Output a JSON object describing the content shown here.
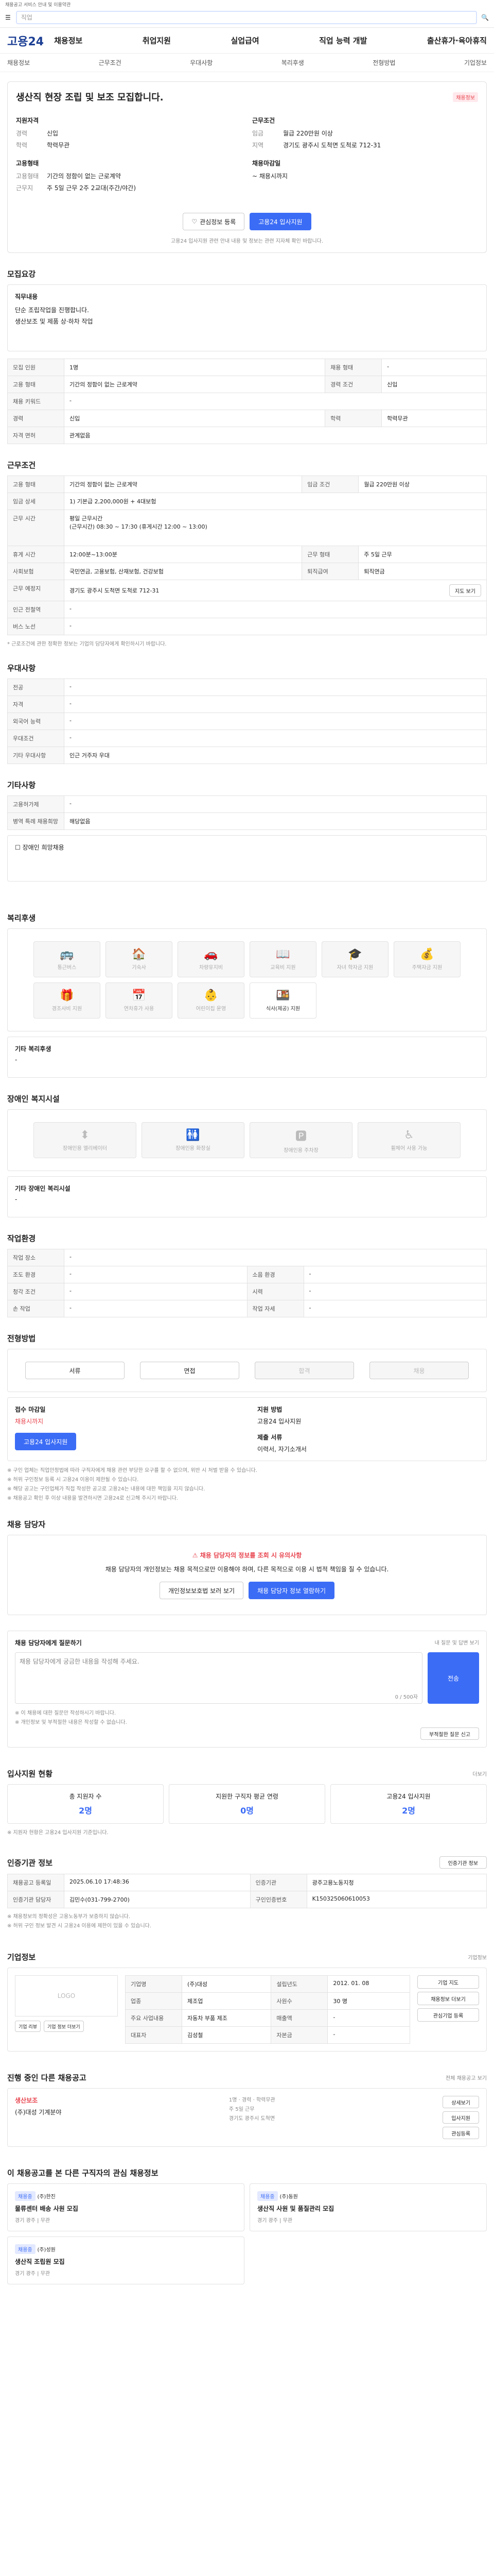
{
  "notice": "채용공고 서비스 안내 및 이용약관",
  "search": {
    "placeholder": "직업"
  },
  "gnb": {
    "logo": "고용24",
    "menu": [
      "채용정보",
      "취업지원",
      "실업급여",
      "직업 능력 개발",
      "출산휴가·육아휴직"
    ]
  },
  "subnav": [
    "채용정보",
    "근무조건",
    "우대사항",
    "복리후생",
    "전형방법",
    "기업정보"
  ],
  "hero": {
    "title": "생산직 현장 조립 및 보조 모집합니다.",
    "badge": "채용정보",
    "left_heading": "지원자격",
    "left": [
      {
        "k": "경력",
        "v": "신입"
      },
      {
        "k": "학력",
        "v": "학력무관"
      }
    ],
    "left2_heading": "고용형태",
    "left2": [
      {
        "k": "고용형태",
        "v": "기간의 정함이 없는 근로계약"
      },
      {
        "k": "근무지",
        "v": "주 5일 근무 2주 2교대(주간/야간)"
      }
    ],
    "right_heading": "근무조건",
    "right": [
      {
        "k": "임금",
        "v": "월급 220만원 이상"
      },
      {
        "k": "지역",
        "v": "경기도 광주시 도척면 도척로 712-31"
      }
    ],
    "right2_heading": "채용마감일",
    "right2": "~ 채용시까지",
    "btn_scrap": "관심정보 등록",
    "btn_apply": "고용24 입사지원",
    "footnote": "고용24 입사지원 관련 안내 내용 및 정보는 관련 지자체 확인 바랍니다."
  },
  "recruit": {
    "title": "모집요강",
    "job_title": "직무내용",
    "job_desc": "단순 조립작업을 진행합니다.\n생산보조 및 제품 상·하차 작업",
    "rows": [
      [
        {
          "k": "모집 인원",
          "v": "1명"
        },
        {
          "k": "채용 형태",
          "v": "-"
        }
      ],
      [
        {
          "k": "고용 형태",
          "v": "기간의 정함이 없는 근로계약"
        },
        {
          "k": "경력 조건",
          "v": "신입"
        }
      ],
      [
        {
          "k": "채용 키워드",
          "v": "-"
        },
        {
          "k": "",
          "v": ""
        }
      ],
      [
        {
          "k": "경력",
          "v": "신입"
        },
        {
          "k": "학력",
          "v": "학력무관"
        }
      ],
      [
        {
          "k": "자격 면허",
          "v": "관계없음"
        },
        {
          "k": "",
          "v": ""
        }
      ]
    ]
  },
  "conditions": {
    "title": "근무조건",
    "rows": [
      [
        {
          "k": "고용 형태",
          "v": "기간의 정함이 없는 근로계약"
        },
        {
          "k": "임금 조건",
          "v": "월급 220만원 이상"
        }
      ],
      [
        {
          "k": "임금 상세",
          "v": "1) 기본급 2,200,000원 + 4대보험"
        },
        {
          "k": "",
          "v": ""
        }
      ],
      [
        {
          "k": "근무 시간",
          "v": "평일 근무시간 \n(근무시간) 08:30 ~ 17:30 (휴게시간 12:00 ~ 13:00)"
        },
        {
          "k": "",
          "v": ""
        }
      ],
      [
        {
          "k": "휴게 시간",
          "v": "12:00분~13:00분"
        },
        {
          "k": "근무 형태",
          "v": "주 5일 근무"
        }
      ],
      [
        {
          "k": "사회보험",
          "v": "국민연금, 고용보험, 산재보험, 건강보험"
        },
        {
          "k": "퇴직급여",
          "v": "퇴직연금"
        }
      ],
      [
        {
          "k": "근무 예정지",
          "v": "경기도 광주시 도척면 도척로 712-31"
        },
        {
          "k": "",
          "v": ""
        }
      ],
      [
        {
          "k": "인근 전철역",
          "v": "-"
        },
        {
          "k": "",
          "v": ""
        }
      ],
      [
        {
          "k": "버스 노선",
          "v": "-"
        },
        {
          "k": "",
          "v": ""
        }
      ]
    ],
    "map_btn": "지도 보기",
    "note": "* 근로조건에 관한 정확한 정보는 기업의 담당자에게 확인하시기 바랍니다."
  },
  "preference": {
    "title": "우대사항",
    "rows": [
      {
        "k": "전공",
        "v": "-"
      },
      {
        "k": "자격",
        "v": "-"
      },
      {
        "k": "외국어 능력",
        "v": "-"
      },
      {
        "k": "우대조건",
        "v": "-"
      },
      {
        "k": "기타 우대사항",
        "v": "인근 거주자 우대"
      }
    ]
  },
  "extra": {
    "title": "기타사항",
    "rows": [
      {
        "k": "고용허가제",
        "v": "-"
      },
      {
        "k": "병역 특례 채용희망",
        "v": "해당없음"
      }
    ],
    "check": "장애인 희망채용"
  },
  "welfare": {
    "title": "복리후생",
    "cards": [
      "통근버스",
      "기숙사",
      "차량유지비",
      "교육비 지원",
      "자녀 학자금 지원",
      "주택자금 지원",
      "경조사비 지원",
      "연차휴가 사용",
      "어린이집 운영",
      "식사(제공) 지원"
    ],
    "active": [
      8,
      9
    ],
    "other_label": "기타 복리후생",
    "other_value": "-"
  },
  "disabled": {
    "title": "장애인 복지시설",
    "cards": [
      "장애인용 엘리베이터",
      "장애인용 화장실",
      "장애인용 주차장",
      "휠체어 사용 가능"
    ],
    "other_label": "기타 장애인 복리시설",
    "other_value": "-"
  },
  "workenv": {
    "title": "작업환경",
    "rows": [
      [
        {
          "k": "작업 장소",
          "v": "-"
        },
        {
          "k": "",
          "v": ""
        }
      ],
      [
        {
          "k": "조도 환경",
          "v": "-"
        },
        {
          "k": "소음 환경",
          "v": "-"
        }
      ],
      [
        {
          "k": "청각 조건",
          "v": "-"
        },
        {
          "k": "시력",
          "v": "-"
        }
      ],
      [
        {
          "k": "손 작업",
          "v": "-"
        },
        {
          "k": "작업 자세",
          "v": "-"
        }
      ]
    ]
  },
  "process": {
    "title": "전형방법",
    "steps": [
      "서류",
      "면접",
      "합격",
      "채용"
    ],
    "left_rows": [
      {
        "k": "접수 마감일",
        "v": "채용시까지"
      },
      {
        "k": "지원 방법",
        "v": "고용24 입사지원"
      }
    ],
    "apply_btn": "고용24 입사지원",
    "docs_label": "제출 서류",
    "docs_value": "이력서, 자기소개서",
    "notes": [
      "※ 구인 업체는 직업안정법에 따라 구직자에게 채용 관련 부당한 요구를 할 수 없으며, 위반 시 처벌 받을 수 있습니다.",
      "※ 허위 구인정보 등록 시 고용24 이용이 제한될 수 있습니다.",
      "※ 해당 공고는 구인업체가 직접 작성한 공고로 고용24는 내용에 대한 책임을 지지 않습니다.",
      "※ 채용공고 확인 후 이상 내용을 발견하시면 고용24로 신고해 주시기 바랍니다."
    ]
  },
  "contact": {
    "title": "채용 담당자",
    "alert": "채용 담당자의 정보를 조회 시 유의사항",
    "desc": "채용 담당자의 개인정보는 채용 목적으로만 이용해야 하며, 다른 목적으로 이용 시 법적 책임을 질 수 있습니다.",
    "btn_view": "개인정보보호법 보러 보기",
    "btn_show": "채용 담당자 정보 열람하기"
  },
  "inquiry": {
    "title": "채용 담당자에게 질문하기",
    "link": "내 질문 및 답변 보기",
    "placeholder": "채용 담당자에게 궁금한 내용을 작성해 주세요.",
    "counter": "0 / 500자",
    "btn": "전송",
    "notes": [
      "※ 이 채용에 대한 질문만 작성하시기 바랍니다.",
      "※ 개인정보 및 부적절한 내용은 작성할 수 없습니다."
    ],
    "report_btn": "부적절한 질문 신고"
  },
  "stats": {
    "title": "입사지원 현황",
    "more": "더보기",
    "items": [
      {
        "label": "총 지원자 수",
        "value": "2명"
      },
      {
        "label": "지원한 구직자 평균 연령",
        "value": "0명"
      },
      {
        "label": "고용24 입사지원",
        "value": "2명"
      }
    ],
    "note": "※ 지원자 현황은 고용24 입사지원 기준입니다."
  },
  "info": {
    "title": "인증기관 정보",
    "btn": "인증기관 정보",
    "rows": [
      [
        {
          "k": "채용공고 등록일",
          "v": "2025.06.10 17:48:36"
        },
        {
          "k": "인증기관",
          "v": "광주고용노동지청"
        }
      ],
      [
        {
          "k": "인증기관 담당자",
          "v": "김민수(031-799-2700)"
        },
        {
          "k": "구인인증번호",
          "v": "K150325060610053"
        }
      ]
    ],
    "notes": [
      "※ 채용정보의 정확성은 고용노동부가 보증하지 않습니다.",
      "※ 허위 구인 정보 발견 시 고용24 이용에 제한이 있을 수 있습니다."
    ]
  },
  "company": {
    "title": "기업정보",
    "more": "기업정보",
    "logo": "LOGO",
    "rows": [
      [
        {
          "k": "기업명",
          "v": "(주)대성"
        },
        {
          "k": "설립년도",
          "v": "2012. 01. 08"
        }
      ],
      [
        {
          "k": "업종",
          "v": "제조업"
        },
        {
          "k": "사원수",
          "v": "30 명"
        }
      ],
      [
        {
          "k": "주요 사업내용",
          "v": "자동차 부품 제조"
        },
        {
          "k": "매출액",
          "v": "-"
        }
      ],
      [
        {
          "k": "대표자",
          "v": "김성철"
        },
        {
          "k": "자본금",
          "v": "-"
        }
      ]
    ],
    "btn_a": "기업 리뷰",
    "btn_b": "기업 정보 더보기",
    "side_btns": [
      "기업 지도",
      "채용정보 더보기",
      "관심기업 등록"
    ]
  },
  "others": {
    "title": "진행 중인 다른 채용공고",
    "more": "전체 채용공고 보기",
    "job_title": "생산보조",
    "company": "(주)대성 기계분야",
    "meta": [
      "1명",
      "경력",
      "학력무관",
      "주 5일 근무",
      "경기도 광주시 도척면"
    ],
    "btns": [
      "상세보기",
      "입사지원",
      "관심등록"
    ]
  },
  "recommend": {
    "title": "이 채용공고를 본 다른 구직자의 관심 채용정보",
    "items": [
      {
        "tag": "채용중",
        "company": "(주)한진",
        "title": "물류센터 배송 사원 모집",
        "meta": "경기 광주 | 무관"
      },
      {
        "tag": "채용중",
        "company": "(주)동원",
        "title": "생산직 사원 및 품질관리 모집",
        "meta": "경기 광주 | 무관"
      },
      {
        "tag": "채용중",
        "company": "(주)성원",
        "title": "생산직 조립원 모집",
        "meta": "경기 광주 | 무관"
      }
    ]
  }
}
